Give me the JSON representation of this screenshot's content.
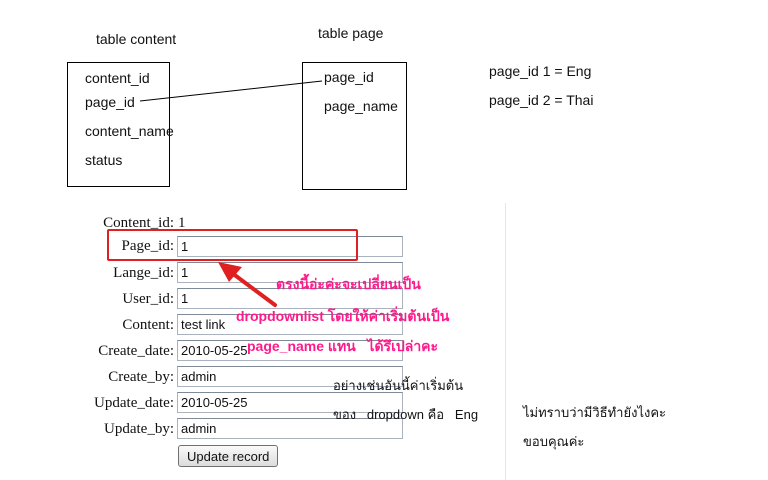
{
  "diagram": {
    "content_table": {
      "title": "table content",
      "fields": [
        "content_id",
        "page_id",
        "content_name",
        "status"
      ]
    },
    "page_table": {
      "title": "table page",
      "fields": [
        "page_id",
        "page_name"
      ]
    },
    "page_values": [
      "page_id 1 = Eng",
      "page_id 2 = Thai"
    ]
  },
  "form": {
    "content_id": {
      "label": "Content_id:",
      "value": "1"
    },
    "page_id": {
      "label": "Page_id:",
      "value": "1"
    },
    "lange_id": {
      "label": "Lange_id:",
      "value": "1"
    },
    "user_id": {
      "label": "User_id:",
      "value": "1"
    },
    "content": {
      "label": "Content:",
      "value": "test link"
    },
    "create_date": {
      "label": "Create_date:",
      "value": "2010-05-25"
    },
    "create_by": {
      "label": "Create_by:",
      "value": "admin"
    },
    "update_date": {
      "label": "Update_date:",
      "value": "2010-05-25"
    },
    "update_by": {
      "label": "Update_by:",
      "value": "admin"
    },
    "submit_label": "Update record"
  },
  "annotation": {
    "lines": [
      "ตรงนี้อ่ะค่ะจะเปลี่ยนเป็น",
      "dropdownlist โดยให้ค่าเริ่มต้นเป็น",
      "page_name แทน   ได้รึเปล่าคะ"
    ],
    "color": "#ff1a8c",
    "highlight_color": "#e02020"
  },
  "notes": {
    "example_line1": "อย่างเช่นอันนี้ค่าเริ่มต้น",
    "example_line2": "ของ   dropdown คือ   Eng",
    "question": "ไม่ทราบว่ามีวิธีทำยังไงคะ",
    "thanks": "ขอบคุณค่ะ"
  }
}
